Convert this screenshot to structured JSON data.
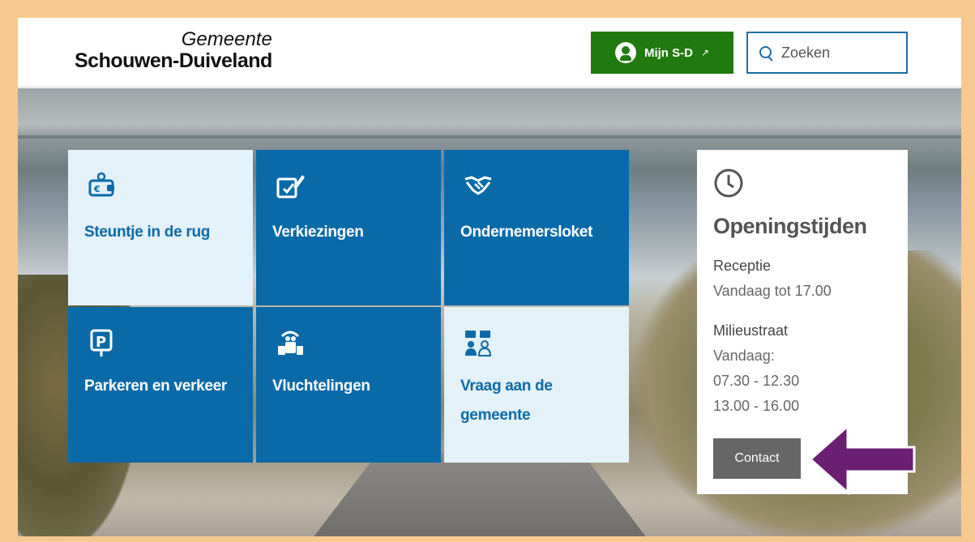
{
  "header": {
    "logo_line1": "Gemeente",
    "logo_line2": "Schouwen-Duiveland",
    "account_button": "Mijn S-D",
    "search_placeholder": "Zoeken"
  },
  "tiles": [
    {
      "label": "Steuntje in de rug",
      "icon": "wallet-euro-icon",
      "style": "light"
    },
    {
      "label": "Verkiezingen",
      "icon": "ballot-pen-icon",
      "style": "dark"
    },
    {
      "label": "Ondernemersloket",
      "icon": "handshake-icon",
      "style": "dark"
    },
    {
      "label": "Parkeren en verkeer",
      "icon": "parking-sign-icon",
      "style": "dark"
    },
    {
      "label": "Vluchtelingen",
      "icon": "refugees-luggage-icon",
      "style": "dark"
    },
    {
      "label": "Vraag aan de gemeente",
      "icon": "chat-people-icon",
      "style": "light"
    }
  ],
  "hours": {
    "title": "Openingstijden",
    "reception_head": "Receptie",
    "reception_time": "Vandaag tot 17.00",
    "milieustraat_head": "Milieustraat",
    "milieustraat_day": "Vandaag:",
    "milieustraat_time1": "07.30 - 12.30",
    "milieustraat_time2": "13.00 - 16.00",
    "contact_button": "Contact"
  },
  "colors": {
    "brand_blue": "#0a6aa8",
    "light_tile": "#e3f1f8",
    "account_green": "#217a0f",
    "annotation_purple": "#6a1f73",
    "frame": "#f5c990"
  }
}
